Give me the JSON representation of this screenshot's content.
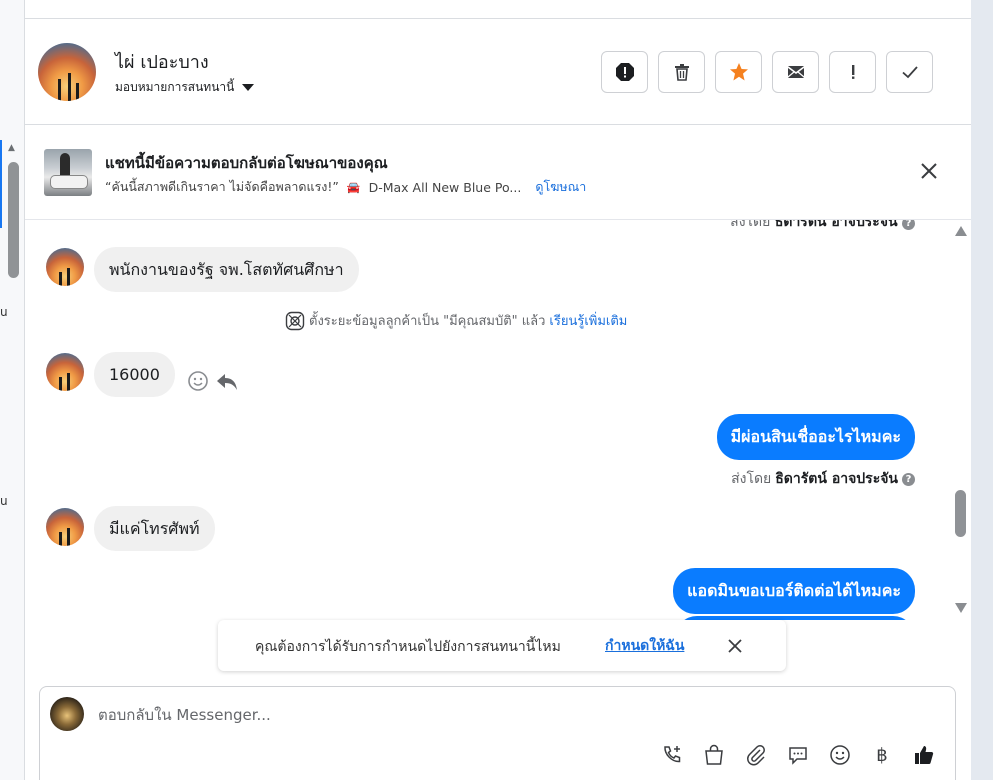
{
  "header": {
    "contact_name": "ไผ่ เปอะบาง",
    "assign_label": "มอบหมายการสนทนานี้"
  },
  "ad_banner": {
    "title": "แชทนี้มีข้อความตอบกลับต่อโฆษณาของคุณ",
    "quote": "“คันนี้สภาพดีเกินราคา ไม่จัดคือพลาดแรง!”",
    "car_emoji": "🚘",
    "ad_name": "D-Max All New Blue Po...",
    "view_ad_label": "ดูโฆษณา"
  },
  "messages": {
    "sent_by_label": "ส่งโดย",
    "cut_sent_by_name": "ธิดารัตน์ อาจประจัน",
    "incoming_1": "พนักงานของรัฐ จพ.โสตทัศนศึกษา",
    "system_text": "ตั้งระยะข้อมูลลูกค้าเป็น \"มีคุณสมบัติ\" แล้ว",
    "system_link": "เรียนรู้เพิ่มเติม",
    "incoming_2": "16000",
    "outgoing_1": "มีผ่อนสินเชื่ออะไรไหมคะ",
    "sent_by_name": "ธิดารัตน์ อาจประจัน",
    "help_glyph": "?",
    "incoming_3": "มีแค่โทรศัพท์",
    "outgoing_2": "แอดมินขอเบอร์ติดต่อได้ไหมคะ"
  },
  "toast": {
    "text": "คุณต้องการได้รับการกำหนดไปยังการสนทนานี้ไหม",
    "link": "กำหนดให้ฉัน"
  },
  "composer": {
    "placeholder": "ตอบกลับใน Messenger..."
  },
  "left_strip": {
    "frag_1": "u",
    "frag_2": "u"
  },
  "tools": {
    "baht_glyph": "฿"
  },
  "colors": {
    "accent": "#1877f2",
    "outgoing_bubble": "#0a7cff",
    "incoming_bubble": "#f0f0f0",
    "star": "#f5811f"
  },
  "icons": {
    "header_actions": [
      "spam-icon",
      "trash-icon",
      "star-icon",
      "envelope-icon",
      "exclamation-icon",
      "checkmark-icon"
    ],
    "composer_tools": [
      "add-call-icon",
      "shopping-bag-icon",
      "paperclip-icon",
      "saved-replies-icon",
      "emoji-icon",
      "baht-icon",
      "thumbs-up-icon"
    ]
  }
}
